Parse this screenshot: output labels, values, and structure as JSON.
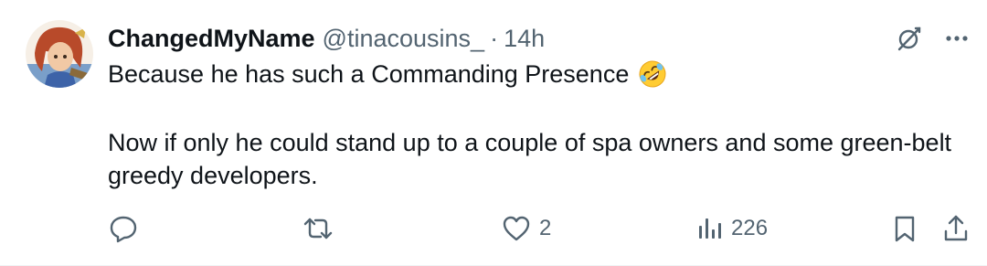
{
  "tweet": {
    "display_name": "ChangedMyName",
    "handle": "@tinacousins_",
    "separator": "·",
    "time": "14h",
    "text_line1": "Because he has such a Commanding Presence",
    "emoji": "rolling-on-floor-laughing-emoji",
    "text_para2": "Now if only he could stand up to a couple of spa owners and some green-belt greedy developers."
  },
  "actions": {
    "reply": {
      "icon": "reply-icon",
      "count": ""
    },
    "retweet": {
      "icon": "retweet-icon",
      "count": ""
    },
    "like": {
      "icon": "heart-icon",
      "count": "2"
    },
    "views": {
      "icon": "views-icon",
      "count": "226"
    },
    "bookmark": {
      "icon": "bookmark-icon"
    },
    "share": {
      "icon": "share-icon"
    }
  },
  "top_actions": {
    "grok": {
      "icon": "grok-icon"
    },
    "more": {
      "icon": "more-icon"
    }
  },
  "colors": {
    "text": "#0f1419",
    "secondary": "#536471",
    "divider": "#eff3f4"
  }
}
